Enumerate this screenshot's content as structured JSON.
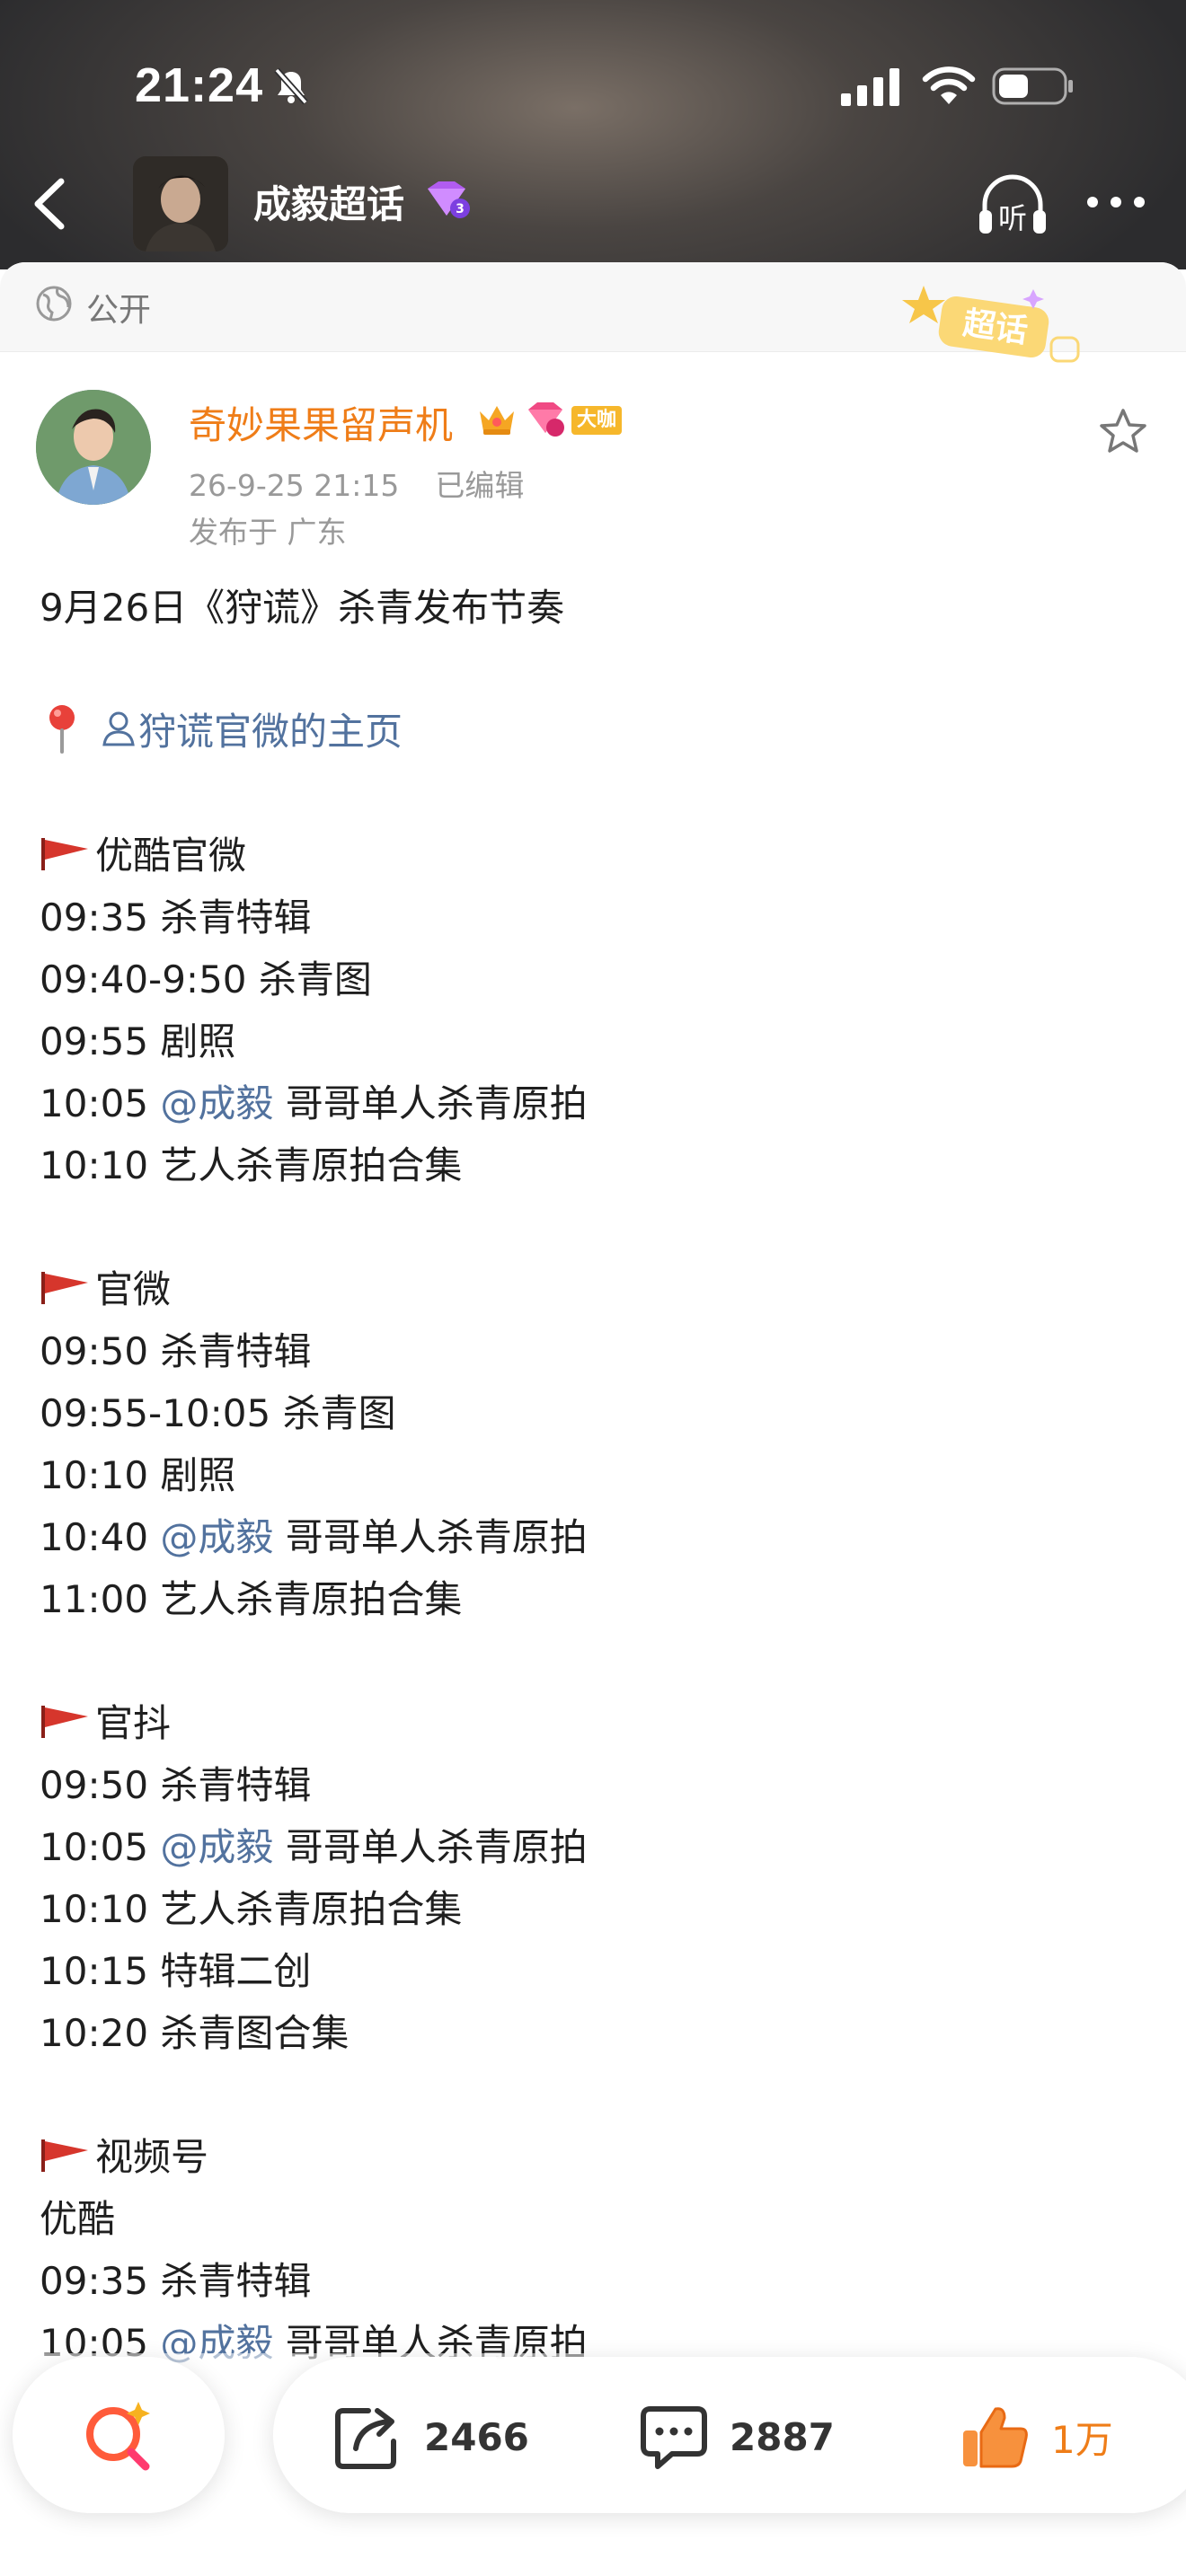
{
  "status_bar": {
    "time": "21:24"
  },
  "nav": {
    "title": "成毅超话"
  },
  "visibility": {
    "label": "公开",
    "badge_text": "超话"
  },
  "author": {
    "name": "奇妙果果留声机",
    "vip_tag": "大咖",
    "timestamp": "26-9-25 21:15",
    "edited": "已编辑",
    "location": "发布于 广东"
  },
  "post": {
    "headline": "9月26日《狩谎》杀青发布节奏",
    "home_link": "狩谎官微的主页",
    "sections": [
      {
        "name": "优酷官微",
        "items": [
          {
            "text": "09:35 杀青特辑"
          },
          {
            "text": "09:40-9:50 杀青图"
          },
          {
            "text": "09:55 剧照"
          },
          {
            "pre": "10:05 ",
            "mention": "@成毅",
            "post": " 哥哥单人杀青原拍"
          },
          {
            "text": "10:10 艺人杀青原拍合集"
          }
        ]
      },
      {
        "name": "官微",
        "items": [
          {
            "text": "09:50 杀青特辑"
          },
          {
            "text": "09:55-10:05 杀青图"
          },
          {
            "text": "10:10 剧照"
          },
          {
            "pre": "10:40 ",
            "mention": "@成毅",
            "post": " 哥哥单人杀青原拍"
          },
          {
            "text": "11:00 艺人杀青原拍合集"
          }
        ]
      },
      {
        "name": "官抖",
        "items": [
          {
            "text": "09:50 杀青特辑"
          },
          {
            "pre": "10:05 ",
            "mention": "@成毅",
            "post": " 哥哥单人杀青原拍"
          },
          {
            "text": "10:10 艺人杀青原拍合集"
          },
          {
            "text": "10:15 特辑二创"
          },
          {
            "text": "10:20 杀青图合集"
          }
        ]
      },
      {
        "name": "视频号",
        "items": [
          {
            "text": "优酷"
          },
          {
            "text": "09:35 杀青特辑"
          },
          {
            "pre": "10:05 ",
            "mention": "@成毅",
            "post": " 哥哥单人杀青原拍"
          }
        ]
      }
    ]
  },
  "actions": {
    "share_count": "2466",
    "comment_count": "2887",
    "like_count": "1万"
  },
  "colors": {
    "accent_orange": "#ef7d18",
    "link_blue": "#52729e",
    "flag_red": "#d6362c"
  }
}
